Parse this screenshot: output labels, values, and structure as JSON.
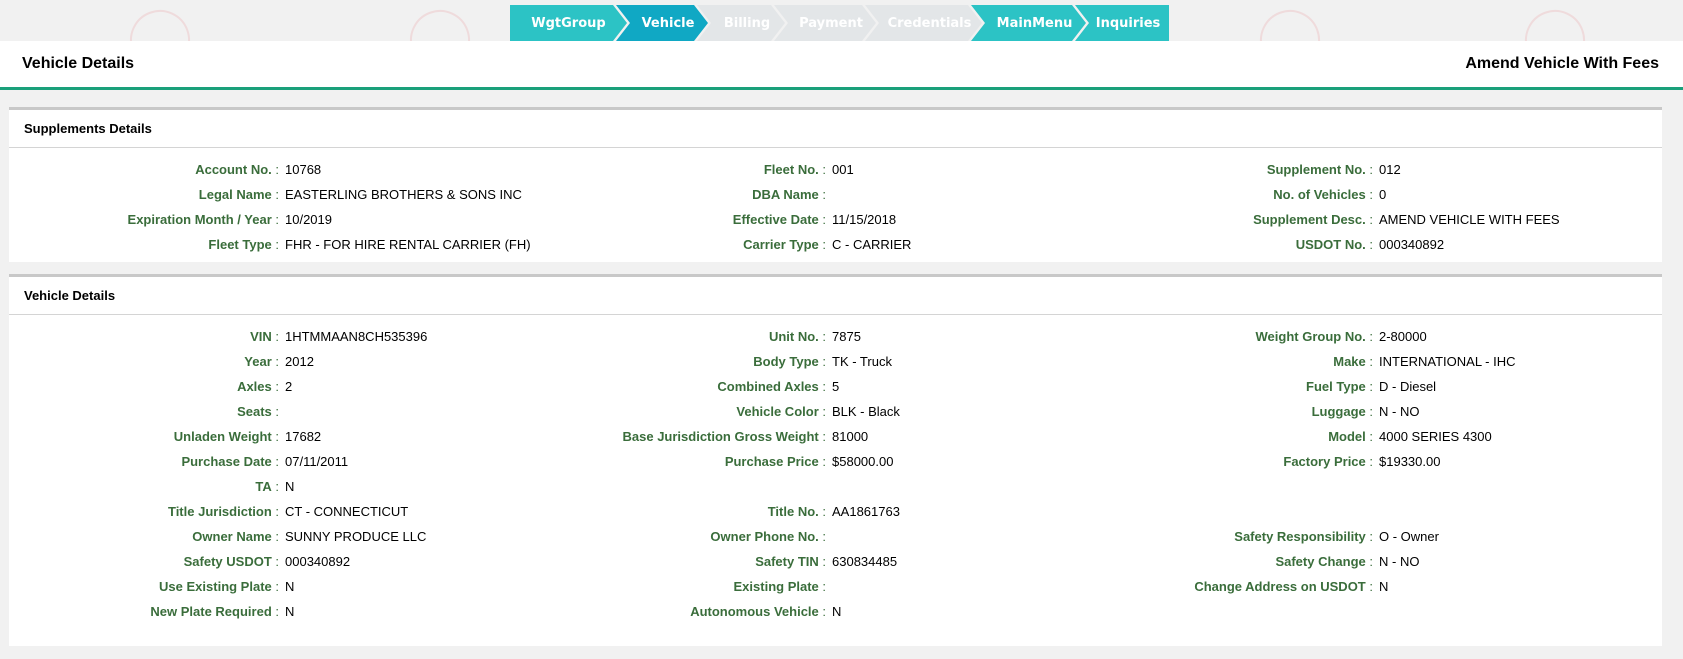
{
  "wizard": {
    "steps": [
      "WgtGroup",
      "Vehicle",
      "Billing",
      "Payment",
      "Credentials",
      "MainMenu",
      "Inquiries"
    ]
  },
  "header": {
    "title": "Vehicle Details",
    "mode": "Amend Vehicle With Fees"
  },
  "supplements": {
    "title": "Supplements Details",
    "rows": [
      [
        {
          "label": "Account No.",
          "value": "10768"
        },
        {
          "label": "Fleet No.",
          "value": "001"
        },
        {
          "label": "Supplement No.",
          "value": "012"
        }
      ],
      [
        {
          "label": "Legal Name",
          "value": "EASTERLING BROTHERS & SONS INC"
        },
        {
          "label": "DBA Name",
          "value": ""
        },
        {
          "label": "No. of Vehicles",
          "value": "0"
        }
      ],
      [
        {
          "label": "Expiration Month / Year",
          "value": "10/2019"
        },
        {
          "label": "Effective Date",
          "value": "11/15/2018"
        },
        {
          "label": "Supplement Desc.",
          "value": "AMEND VEHICLE WITH FEES"
        }
      ],
      [
        {
          "label": "Fleet Type",
          "value": "FHR - FOR HIRE RENTAL CARRIER (FH)"
        },
        {
          "label": "Carrier Type",
          "value": "C - CARRIER"
        },
        {
          "label": "USDOT No.",
          "value": "000340892"
        }
      ]
    ]
  },
  "vehicle": {
    "title": "Vehicle Details",
    "rows": [
      [
        {
          "label": "VIN",
          "value": "1HTMMAAN8CH535396"
        },
        {
          "label": "Unit No.",
          "value": "7875"
        },
        {
          "label": "Weight Group No.",
          "value": "2-80000"
        }
      ],
      [
        {
          "label": "Year",
          "value": "2012"
        },
        {
          "label": "Body Type",
          "value": "TK - Truck"
        },
        {
          "label": "Make",
          "value": "INTERNATIONAL - IHC"
        }
      ],
      [
        {
          "label": "Axles",
          "value": "2"
        },
        {
          "label": "Combined Axles",
          "value": "5"
        },
        {
          "label": "Fuel Type",
          "value": "D - Diesel"
        }
      ],
      [
        {
          "label": "Seats",
          "value": ""
        },
        {
          "label": "Vehicle Color",
          "value": "BLK - Black"
        },
        {
          "label": "Luggage",
          "value": "N - NO"
        }
      ],
      [
        {
          "label": "Unladen Weight",
          "value": "17682"
        },
        {
          "label": "Base Jurisdiction Gross Weight",
          "value": "81000"
        },
        {
          "label": "Model",
          "value": "4000 SERIES 4300"
        }
      ],
      [
        {
          "label": "Purchase Date",
          "value": "07/11/2011"
        },
        {
          "label": "Purchase Price",
          "value": "$58000.00"
        },
        {
          "label": "Factory Price",
          "value": "$19330.00"
        }
      ],
      [
        {
          "label": "TA",
          "value": "N"
        },
        {
          "label": "",
          "value": ""
        },
        {
          "label": "",
          "value": ""
        }
      ],
      [
        {
          "label": "Title Jurisdiction",
          "value": "CT - CONNECTICUT"
        },
        {
          "label": "Title No.",
          "value": "AA1861763"
        },
        {
          "label": "",
          "value": ""
        }
      ],
      [
        {
          "label": "Owner Name",
          "value": "SUNNY PRODUCE LLC"
        },
        {
          "label": "Owner Phone No.",
          "value": ""
        },
        {
          "label": "Safety Responsibility",
          "value": "O - Owner"
        }
      ],
      [
        {
          "label": "Safety USDOT",
          "value": "000340892"
        },
        {
          "label": "Safety TIN",
          "value": "630834485"
        },
        {
          "label": "Safety Change",
          "value": "N - NO"
        }
      ],
      [
        {
          "label": "Use Existing Plate",
          "value": "N"
        },
        {
          "label": "Existing Plate",
          "value": ""
        },
        {
          "label": "Change Address on USDOT",
          "value": "N"
        }
      ],
      [
        {
          "label": "New Plate Required",
          "value": "N"
        },
        {
          "label": "Autonomous Vehicle",
          "value": "N"
        },
        {
          "label": "",
          "value": ""
        }
      ]
    ]
  },
  "colors": {
    "step_done": "#2cc3c5",
    "step_active": "#10a8c4",
    "step_disabled": "#e3e6e8",
    "label_green": "#3a6d3b",
    "header_underline": "#1aa07a"
  }
}
